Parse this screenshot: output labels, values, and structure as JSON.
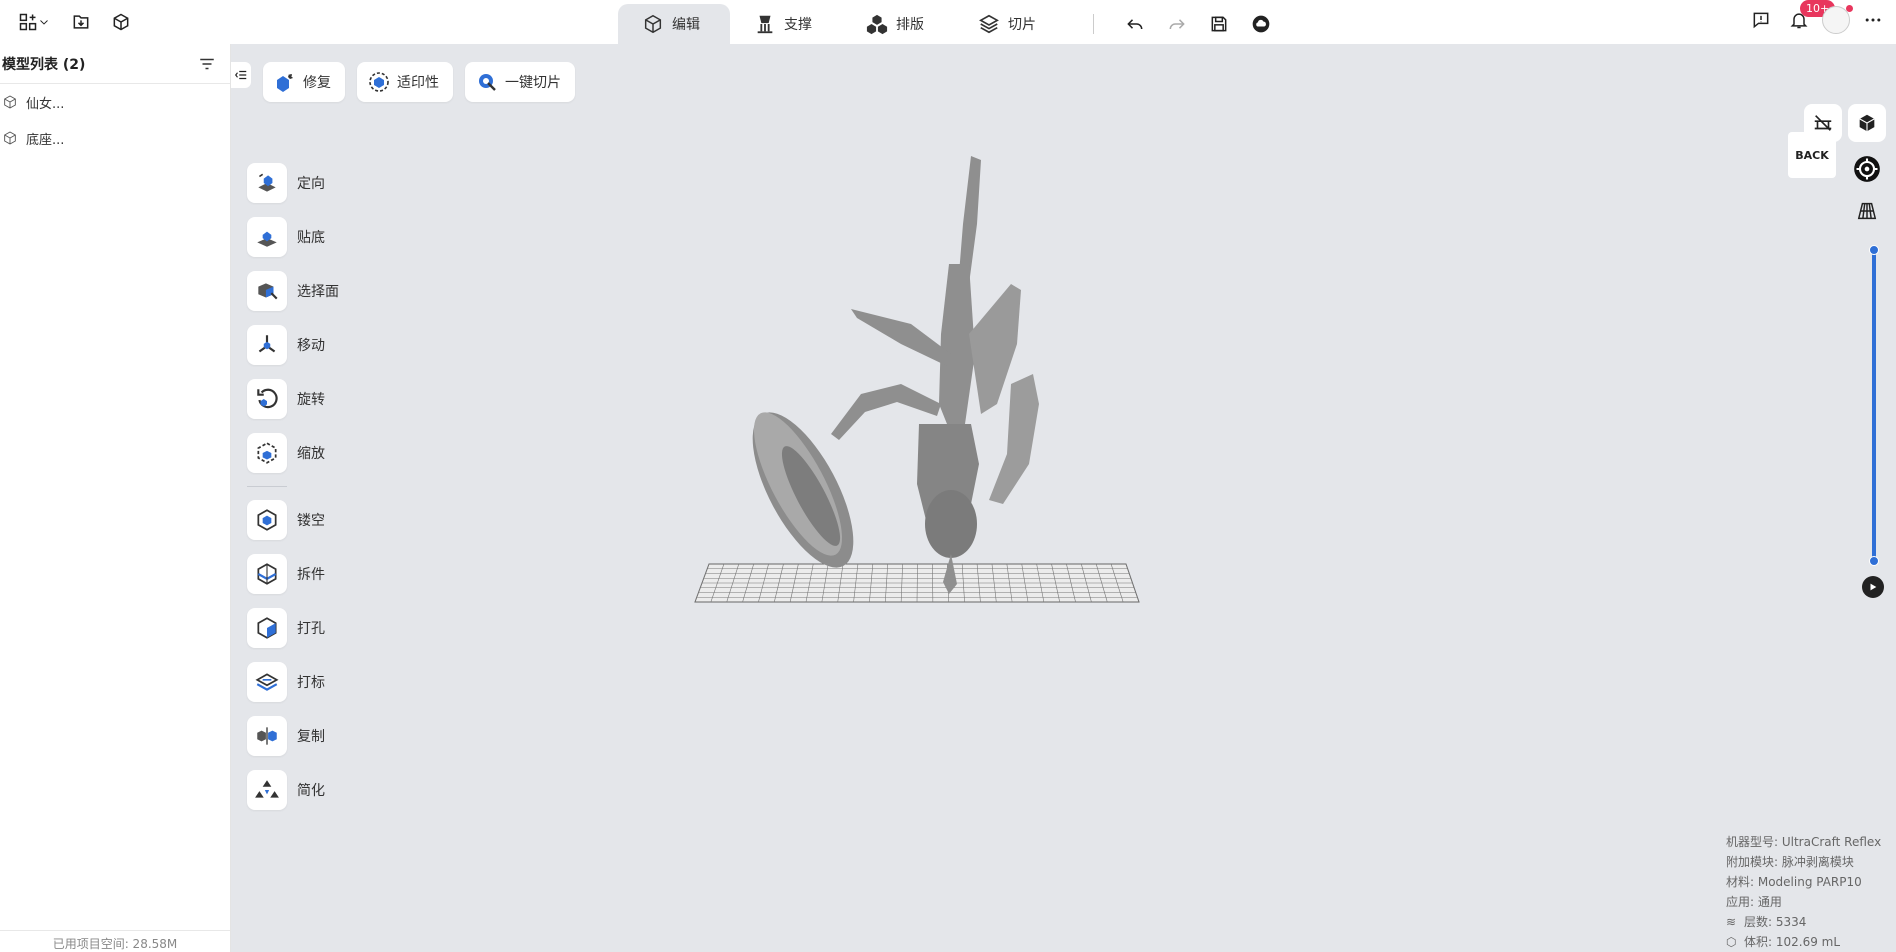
{
  "topbar": {
    "tabs": [
      {
        "label": "编辑",
        "icon": "cube-outline-icon",
        "active": true
      },
      {
        "label": "支撑",
        "icon": "support-icon",
        "active": false
      },
      {
        "label": "排版",
        "icon": "arrange-icon",
        "active": false
      },
      {
        "label": "切片",
        "icon": "layers-icon",
        "active": false
      }
    ],
    "notifications_badge": "10+"
  },
  "sidebar": {
    "title": "模型列表 (2)",
    "models": [
      {
        "name": "仙女..."
      },
      {
        "name": "底座..."
      }
    ],
    "footer": "已用项目空间: 28.58M"
  },
  "actions": [
    {
      "label": "修复"
    },
    {
      "label": "适印性"
    },
    {
      "label": "一键切片"
    }
  ],
  "tools": [
    {
      "label": "定向",
      "icon": "orient-icon"
    },
    {
      "label": "贴底",
      "icon": "lay-flat-icon"
    },
    {
      "label": "选择面",
      "icon": "select-face-icon"
    },
    {
      "label": "移动",
      "icon": "move-icon"
    },
    {
      "label": "旋转",
      "icon": "rotate-icon"
    },
    {
      "label": "缩放",
      "icon": "scale-icon"
    },
    {
      "label": "镂空",
      "icon": "hollow-icon"
    },
    {
      "label": "拆件",
      "icon": "split-icon"
    },
    {
      "label": "打孔",
      "icon": "punch-hole-icon"
    },
    {
      "label": "打标",
      "icon": "label-icon"
    },
    {
      "label": "复制",
      "icon": "duplicate-icon"
    },
    {
      "label": "简化",
      "icon": "simplify-icon"
    }
  ],
  "view": {
    "back_label": "BACK",
    "slider_top_fraction": 1.0,
    "slider_bottom_fraction": 0.0
  },
  "info": {
    "machine": "机器型号: UltraCraft Reflex",
    "module": "附加模块: 脉冲剥离模块",
    "material": "材料: Modeling PARP10",
    "application": "应用: 通用",
    "layers": "层数: 5334",
    "volume": "体积: 102.69 mL"
  },
  "colors": {
    "accent": "#2f6fd6",
    "badge": "#e8365d",
    "viewport_bg": "#e4e6ea"
  }
}
